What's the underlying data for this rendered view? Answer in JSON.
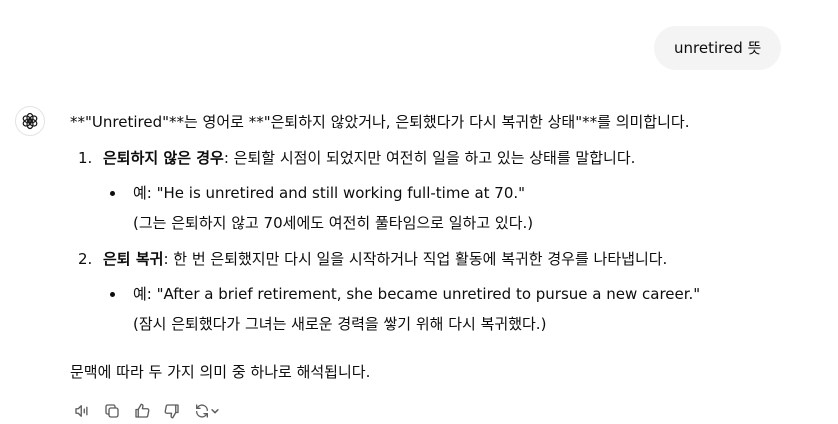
{
  "user_message": "unretired 뜻",
  "answer": {
    "intro": "**\"Unretired\"**는 영어로 **\"은퇴하지 않았거나, 은퇴했다가 다시 복귀한 상태\"**를 의미합니다.",
    "items": [
      {
        "number": "1.",
        "term": "은퇴하지 않은 경우",
        "description": ": 은퇴할 시점이 되었지만 여전히 일을 하고 있는 상태를 말합니다.",
        "example": "예: \"He is unretired and still working full-time at 70.\"",
        "translation": "(그는 은퇴하지 않고 70세에도 여전히 풀타임으로 일하고 있다.)"
      },
      {
        "number": "2.",
        "term": "은퇴 복귀",
        "description": ": 한 번 은퇴했지만 다시 일을 시작하거나 직업 활동에 복귀한 경우를 나타냅니다.",
        "example": "예: \"After a brief retirement, she became unretired to pursue a new career.\"",
        "translation": "(잠시 은퇴했다가 그녀는 새로운 경력을 쌓기 위해 다시 복귀했다.)"
      }
    ],
    "conclusion": "문맥에 따라 두 가지 의미 중 하나로 해석됩니다."
  },
  "actions": [
    "read-aloud-icon",
    "copy-icon",
    "thumbs-up-icon",
    "thumbs-down-icon",
    "regenerate-icon"
  ]
}
